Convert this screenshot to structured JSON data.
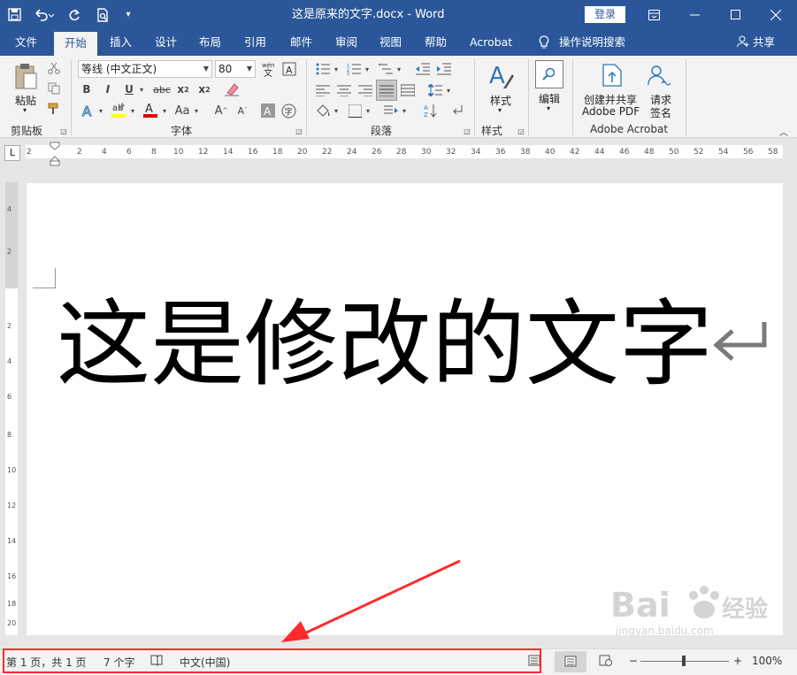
{
  "window": {
    "title": "这是原来的文字.docx  -  Word",
    "login_label": "登录",
    "share_label": "共享"
  },
  "tabs": [
    "文件",
    "开始",
    "插入",
    "设计",
    "布局",
    "引用",
    "邮件",
    "审阅",
    "视图",
    "帮助",
    "Acrobat"
  ],
  "tell_me": "操作说明搜索",
  "ribbon": {
    "clipboard": {
      "paste": "粘贴",
      "label": "剪贴板"
    },
    "font": {
      "name": "等线 (中文正文)",
      "size": "80",
      "label": "字体"
    },
    "paragraph": {
      "label": "段落"
    },
    "styles": {
      "button": "样式",
      "label": "样式"
    },
    "editing": {
      "button": "编辑"
    },
    "acrobat": {
      "create_line1": "创建并共享",
      "create_line2": "Adobe PDF",
      "request_line1": "请求",
      "request_line2": "签名",
      "label": "Adobe Acrobat"
    }
  },
  "ruler": {
    "tab_selector": "L",
    "ticks": [
      "2",
      "2",
      "4",
      "6",
      "8",
      "10",
      "12",
      "14",
      "16",
      "18",
      "20",
      "22",
      "24",
      "26",
      "28",
      "30",
      "32",
      "34",
      "36",
      "38",
      "40",
      "42",
      "44",
      "46",
      "48",
      "50",
      "52",
      "54",
      "56",
      "58"
    ],
    "vertical_ticks": [
      "4",
      "2",
      "2",
      "4",
      "6",
      "8",
      "10",
      "12",
      "14",
      "16",
      "18",
      "20"
    ]
  },
  "document": {
    "text": "这是修改的文字"
  },
  "status": {
    "page": "第 1 页，共 1 页",
    "words": "7 个字",
    "language": "中文(中国)",
    "zoom": "100%"
  },
  "watermark": {
    "text1": "Bai",
    "text2": "经验",
    "url": "jingyan.baidu.com"
  },
  "colors": {
    "brand": "#2b579a",
    "highlight": "#ff2a2a"
  }
}
